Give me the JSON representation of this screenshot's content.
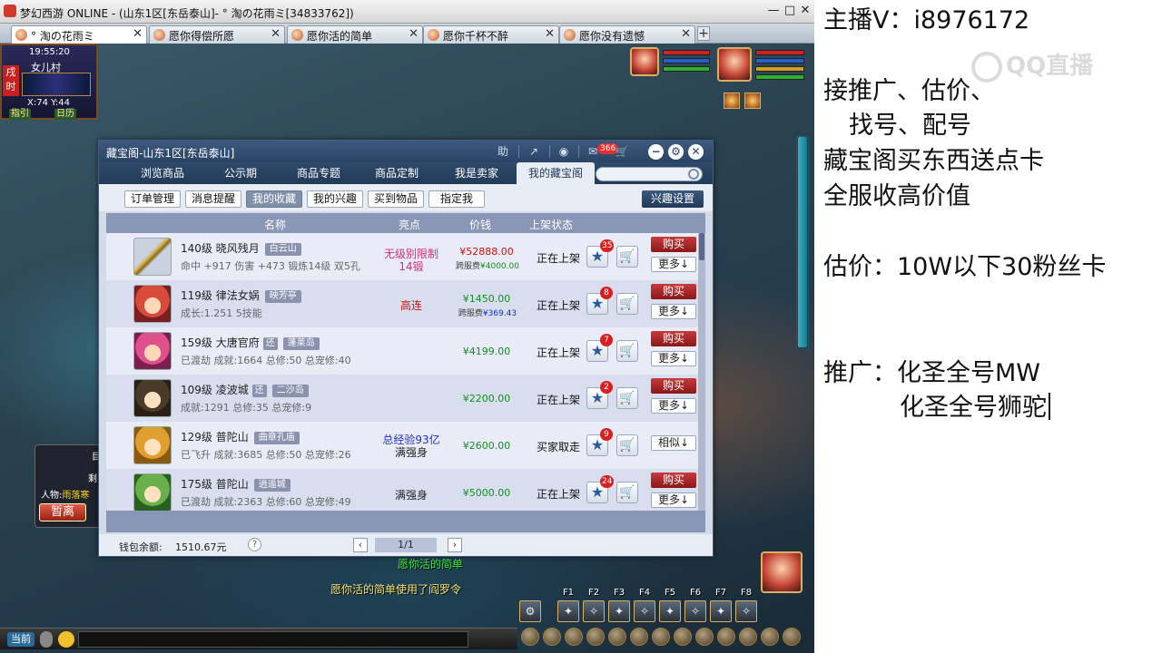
{
  "window": {
    "title": "梦幻西游 ONLINE - (山东1区[东岳泰山]- ° 淘の花雨ミ[34833762])",
    "controls": [
      "—",
      "□",
      "✕"
    ]
  },
  "tabs": [
    {
      "label": "° 淘の花雨ミ",
      "active": true
    },
    {
      "label": "愿你得偿所愿",
      "active": false
    },
    {
      "label": "愿你活的简单",
      "active": false
    },
    {
      "label": "愿你千杯不醉",
      "active": false
    },
    {
      "label": "愿你没有遗憾",
      "active": false
    }
  ],
  "tab_add": "+",
  "minimap": {
    "time": "19:55:20",
    "location": "女儿村",
    "coords": "X:74  Y:44",
    "seal": "戌时",
    "nav_left": "指引",
    "nav_right": "日历"
  },
  "team_panel": {
    "row1": "目",
    "row2": "剩",
    "person_label": "人物:",
    "person_value": "雨落寒",
    "leave_button": "暂离"
  },
  "chat": {
    "line1": "愿你活的简单",
    "line2": "愿你活的简单使用了阎罗令",
    "send_label": "当前"
  },
  "skillbar": {
    "keys": [
      "F1",
      "F2",
      "F3",
      "F4",
      "F5",
      "F6",
      "F7",
      "F8"
    ]
  },
  "dialog": {
    "title": "藏宝阁-山东1区[东岳泰山]",
    "help_label": "助",
    "notify_count": "366",
    "nav_tabs": [
      "浏览商品",
      "公示期",
      "商品专题",
      "商品定制",
      "我是卖家",
      "我的藏宝阁"
    ],
    "active_nav": 5,
    "sub_tabs": [
      "订单管理",
      "消息提醒",
      "我的收藏",
      "我的兴趣",
      "买到物品",
      "指定我"
    ],
    "active_sub": 2,
    "interest_settings": "兴趣设置",
    "columns": [
      "名称",
      "亮点",
      "价钱",
      "上架状态"
    ],
    "rows": [
      {
        "avatar": "weapon",
        "level": "140级",
        "name": "晓风残月",
        "tag": "白云山",
        "tag2": "",
        "detail": "命中 +917 伤害 +473 锻炼14级 双5孔",
        "highlight1": "无级别限制",
        "highlight2": "14锻",
        "hl_color": "pink",
        "price": "¥52888.00",
        "price_color": "red",
        "fee_label": "跨服费",
        "fee_value": "¥4000.00",
        "fee_color": "g",
        "status": "正在上架",
        "fav_count": "35",
        "action": "购买",
        "more": "更多↓"
      },
      {
        "avatar": "face",
        "level": "119级",
        "name": "律法女娲",
        "tag": "映芳亭",
        "tag2": "",
        "detail": "成长:1.251 5技能",
        "highlight1": "高连",
        "highlight2": "",
        "hl_color": "red",
        "price": "¥1450.00",
        "price_color": "green",
        "fee_label": "跨服费",
        "fee_value": "¥369.43",
        "fee_color": "b",
        "status": "正在上架",
        "fav_count": "8",
        "action": "购买",
        "more": "更多↓"
      },
      {
        "avatar": "face2",
        "level": "159级",
        "name": "大唐官府",
        "tag": "蓬莱岛",
        "tag2": "还",
        "detail": "已渡劫 成就:1664 总修:50 总宠修:40",
        "highlight1": "",
        "highlight2": "",
        "hl_color": "black",
        "price": "¥4199.00",
        "price_color": "green",
        "fee_label": "",
        "fee_value": "",
        "fee_color": "g",
        "status": "正在上架",
        "fav_count": "7",
        "action": "购买",
        "more": "更多↓"
      },
      {
        "avatar": "face3",
        "level": "109级",
        "name": "凌波城",
        "tag": "二沙岛",
        "tag2": "还",
        "detail": "成就:1291 总修:35 总宠修:9",
        "highlight1": "",
        "highlight2": "",
        "hl_color": "black",
        "price": "¥2200.00",
        "price_color": "green",
        "fee_label": "",
        "fee_value": "",
        "fee_color": "g",
        "status": "正在上架",
        "fav_count": "2",
        "action": "购买",
        "more": "更多↓"
      },
      {
        "avatar": "face4",
        "level": "129级",
        "name": "普陀山",
        "tag": "曲章孔庙",
        "tag2": "",
        "detail": "已飞升 成就:3685 总修:50 总宠修:26",
        "highlight1": "总经验93亿",
        "highlight2": "满强身",
        "hl_color": "blue",
        "price": "¥2600.00",
        "price_color": "green",
        "fee_label": "",
        "fee_value": "",
        "fee_color": "g",
        "status": "买家取走",
        "fav_count": "9",
        "action": "",
        "more": "相似↓"
      },
      {
        "avatar": "face5",
        "level": "175级",
        "name": "普陀山",
        "tag": "逍遥城",
        "tag2": "",
        "detail": "已渡劫 成就:2363 总修:60 总宠修:49",
        "highlight1": "满强身",
        "highlight2": "",
        "hl_color": "black",
        "price": "¥5000.00",
        "price_color": "green",
        "fee_label": "",
        "fee_value": "",
        "fee_color": "g",
        "status": "正在上架",
        "fav_count": "24",
        "action": "购买",
        "more": "更多↓"
      }
    ],
    "wallet_label": "钱包余额:",
    "wallet_value": "1510.67元",
    "help_q": "?",
    "prev": "‹",
    "next": "›",
    "page": "1/1"
  },
  "overlay": {
    "line1": "主播V：i8976172",
    "line2": "接推广、估价、",
    "line3": "找号、配号",
    "line4": "藏宝阁买东西送点卡",
    "line5": "全服收高价值",
    "line6": "估价：10W以下30粉丝卡",
    "line7": "推广：化圣全号MW",
    "line8": "化圣全号狮驼",
    "watermark": "QQ直播"
  },
  "colors": {
    "dialog_header": "#2a4466",
    "buy_red": "#a82828",
    "price_green": "#109020",
    "price_red": "#d01010"
  }
}
